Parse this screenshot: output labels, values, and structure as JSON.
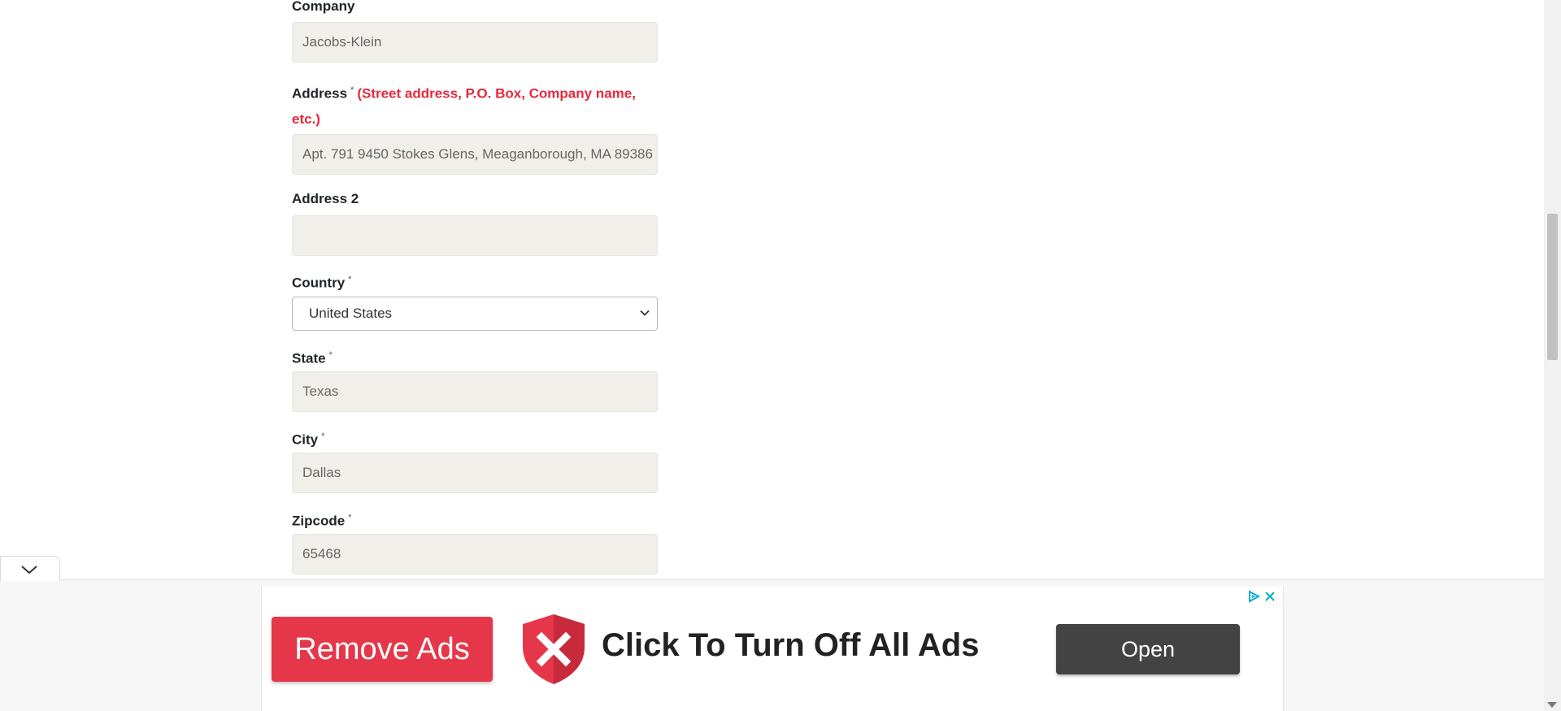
{
  "form": {
    "company_label": "Company",
    "company_value": "Jacobs-Klein",
    "address_label": "Address",
    "required_mark": "*",
    "address_hint": "(Street address, P.O. Box, Company name, etc.)",
    "address_value": "Apt. 791 9450 Stokes Glens, Meaganborough, MA 89386",
    "address2_label": "Address 2",
    "address2_value": "",
    "country_label": "Country",
    "country_value": "United States",
    "state_label": "State",
    "state_value": "Texas",
    "city_label": "City",
    "city_value": "Dallas",
    "zipcode_label": "Zipcode",
    "zipcode_value": "65468"
  },
  "ad": {
    "remove_ads_label": "Remove Ads",
    "headline": "Click To Turn Off All Ads",
    "open_label": "Open",
    "icons": [
      "shield-x-icon",
      "adchoices-icon",
      "close-icon",
      "chevron-down-icon"
    ]
  },
  "colors": {
    "hint_red": "#e6283c",
    "input_bg": "#f0efe9",
    "remove_ads_bg": "#e6374a",
    "open_bg": "#434343",
    "adchoices": "#00aecd"
  }
}
